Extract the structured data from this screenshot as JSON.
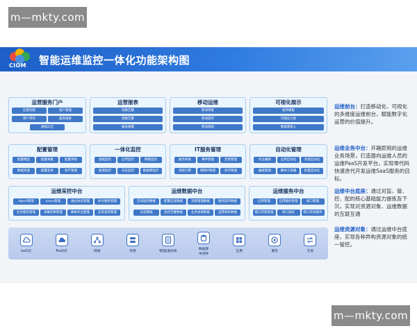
{
  "watermark": "m—mkty.com",
  "banner": {
    "logo_text": "CIOM",
    "title": "智能运维监控一体化功能架构图",
    "logo_colors": [
      "#e94d3d",
      "#f4b400",
      "#34a853",
      "#4a90e2"
    ]
  },
  "rows": [
    {
      "modules": [
        {
          "title": "运营服务门户",
          "items": [
            "应服流程",
            "组户管理",
            "用户单色",
            "服务搜索",
            "通知公告"
          ]
        },
        {
          "title": "运营报表",
          "items": [
            "指数告警",
            "指数告警",
            "报表报警"
          ]
        },
        {
          "title": "移动运维",
          "items": [
            "移动审批",
            "移动操作",
            "移动值班"
          ]
        },
        {
          "title": "可视化展示",
          "items": [
            "组件模板",
            "可视化大屏",
            "数据源接入"
          ]
        }
      ]
    },
    {
      "modules": [
        {
          "title": "配置管理",
          "items": [
            "配置模型",
            "配置采集",
            "配置审核",
            "数据资源",
            "配置变更",
            "资产管理"
          ]
        },
        {
          "title": "一体化监控",
          "items": [
            "基础监控",
            "应用监控",
            "网络监控",
            "拨测监控",
            "日志监控",
            "数据库监控"
          ]
        },
        {
          "title": "IT服务管理",
          "items": [
            "服务目录",
            "事件管理",
            "变更管理",
            "流程引擎",
            "网络IP管理",
            "知识管理"
          ]
        },
        {
          "title": "自动化管理",
          "items": [
            "作业编排",
            "应用自动化",
            "资源自动化",
            "编排管理",
            "脚本工具箱",
            "批量自动化"
          ]
        }
      ]
    },
    {
      "modules": [
        {
          "title": "运维采控中台",
          "items": [
            "Agent管理",
            "proxy管理",
            "通过协议管理",
            "命令服务管理",
            "任务服务管理",
            "采集控制管理",
            "脚本作业管理",
            "信息发现管理"
          ]
        },
        {
          "title": "运维数据中台",
          "items": [
            "告知监控数据",
            "配置信息数据",
            "流程管理数据",
            "服务操作数据",
            "日志数据",
            "监控告警数据",
            "业务关联数据",
            "运营指标数据"
          ]
        },
        {
          "title": "运维服务中台",
          "items": [
            "应用管理",
            "应用服务管理",
            "接口管理",
            "接口开放管理",
            "接口鉴权",
            "接口开放服务"
          ]
        }
      ]
    }
  ],
  "resources": [
    {
      "label": "IaaS云",
      "icon": "cloud-iaas-icon"
    },
    {
      "label": "PaaS云",
      "icon": "cloud-paas-icon"
    },
    {
      "label": "网络",
      "icon": "network-icon"
    },
    {
      "label": "存储",
      "icon": "storage-icon"
    },
    {
      "label": "物理/虚拟机",
      "icon": "server-icon"
    },
    {
      "label": "数据库\n中间件",
      "icon": "database-icon"
    },
    {
      "label": "应用",
      "icon": "application-icon"
    },
    {
      "label": "服务",
      "icon": "service-icon"
    },
    {
      "label": "交易",
      "icon": "transaction-icon"
    }
  ],
  "descriptions": [
    {
      "head": "运维前台：",
      "body": "打造移动化、可视化的多维度运维前台，赋能数字化运营的价值提升。"
    },
    {
      "head": "运维业务中台：",
      "body": "开箱即用的运维业务场景，打造面向运维人员的运维PaaS开发平台，实现零代码快速迭代开发运维SaaS服务的目标。"
    },
    {
      "head": "运维中台底座：",
      "body": "通过对监、管、控、配的核心基础能力提炼及下沉，实现对资源对象、运维数据的互联互通"
    },
    {
      "head": "运维资源对象：",
      "body": "通过运维中台底座，实现各种异构资源对象的统一管控。"
    }
  ]
}
